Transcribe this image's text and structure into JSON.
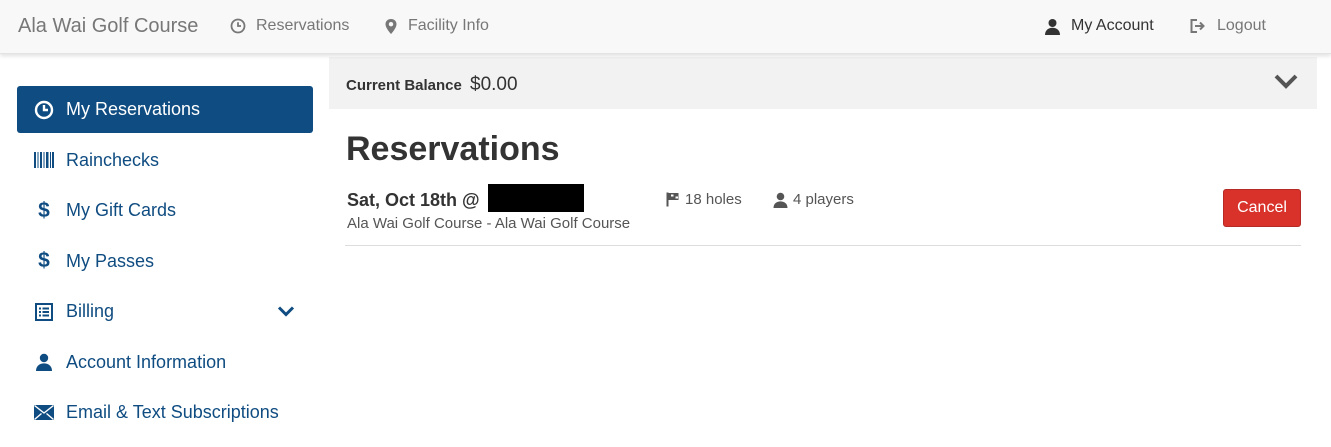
{
  "header": {
    "brand": "Ala Wai Golf Course",
    "nav": [
      {
        "label": "Reservations",
        "icon": "clock-icon"
      },
      {
        "label": "Facility Info",
        "icon": "map-marker-icon"
      }
    ],
    "account_label": "My Account",
    "logout_label": "Logout"
  },
  "sidebar": {
    "items": [
      {
        "label": "My Reservations",
        "icon": "clock-icon",
        "active": true
      },
      {
        "label": "Rainchecks",
        "icon": "barcode-icon"
      },
      {
        "label": "My Gift Cards",
        "icon": "dollar-icon"
      },
      {
        "label": "My Passes",
        "icon": "dollar-icon"
      },
      {
        "label": "Billing",
        "icon": "list-icon",
        "expandable": true
      },
      {
        "label": "Account Information",
        "icon": "user-icon"
      },
      {
        "label": "Email & Text Subscriptions",
        "icon": "envelope-icon"
      }
    ]
  },
  "balance": {
    "label": "Current Balance",
    "value": "$0.00"
  },
  "main": {
    "title": "Reservations",
    "reservations": [
      {
        "date": "Sat, Oct 18th @",
        "course": "Ala Wai Golf Course - Ala Wai Golf Course",
        "holes": "18 holes",
        "players": "4 players",
        "cancel_label": "Cancel"
      }
    ]
  },
  "colors": {
    "primary": "#0f4c81",
    "danger": "#d9322b",
    "nav_bg": "#f8f8f8",
    "balance_bg": "#f2f2f2"
  }
}
